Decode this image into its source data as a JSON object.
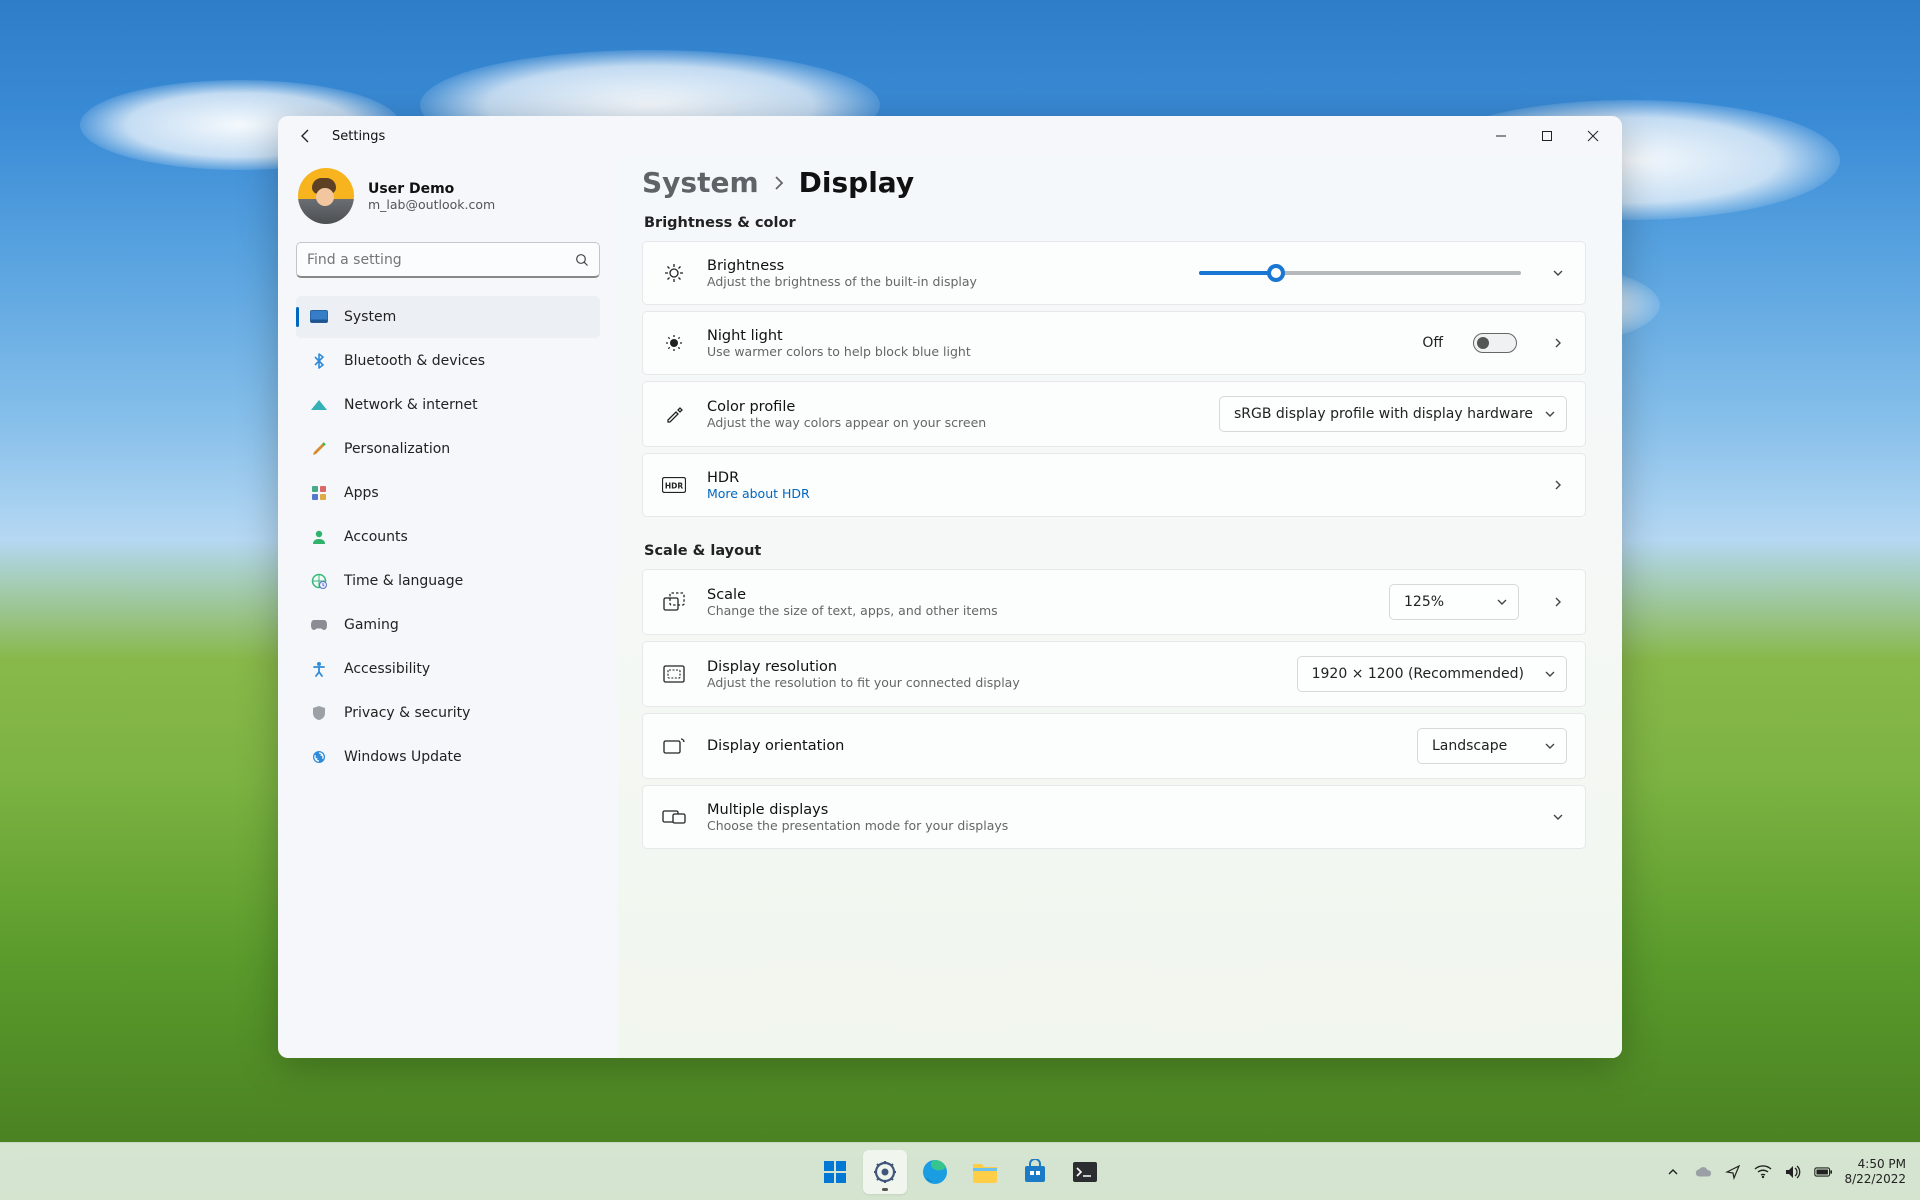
{
  "window": {
    "title": "Settings"
  },
  "profile": {
    "name": "User Demo",
    "email": "m_lab@outlook.com"
  },
  "search": {
    "placeholder": "Find a setting"
  },
  "nav": {
    "items": [
      {
        "label": "System"
      },
      {
        "label": "Bluetooth & devices"
      },
      {
        "label": "Network & internet"
      },
      {
        "label": "Personalization"
      },
      {
        "label": "Apps"
      },
      {
        "label": "Accounts"
      },
      {
        "label": "Time & language"
      },
      {
        "label": "Gaming"
      },
      {
        "label": "Accessibility"
      },
      {
        "label": "Privacy & security"
      },
      {
        "label": "Windows Update"
      }
    ],
    "active_index": 0
  },
  "breadcrumb": {
    "parent": "System",
    "current": "Display"
  },
  "sections": {
    "brightness": {
      "title": "Brightness & color",
      "brightness": {
        "label": "Brightness",
        "sub": "Adjust the brightness of the built-in display",
        "value_percent": 24
      },
      "night_light": {
        "label": "Night light",
        "sub": "Use warmer colors to help block blue light",
        "state_label": "Off",
        "state": false
      },
      "color_profile": {
        "label": "Color profile",
        "sub": "Adjust the way colors appear on your screen",
        "dropdown_value": "sRGB display profile with display hardware c"
      },
      "hdr": {
        "label": "HDR",
        "link": "More about HDR"
      }
    },
    "scale": {
      "title": "Scale & layout",
      "scale": {
        "label": "Scale",
        "sub": "Change the size of text, apps, and other items",
        "dropdown_value": "125%"
      },
      "resolution": {
        "label": "Display resolution",
        "sub": "Adjust the resolution to fit your connected display",
        "dropdown_value": "1920 × 1200 (Recommended)"
      },
      "orientation": {
        "label": "Display orientation",
        "dropdown_value": "Landscape"
      },
      "multiple": {
        "label": "Multiple displays",
        "sub": "Choose the presentation mode for your displays"
      }
    }
  },
  "taskbar": {
    "time": "4:50 PM",
    "date": "8/22/2022"
  },
  "colors": {
    "accent": "#0067c0",
    "slider": "#1976d2"
  }
}
